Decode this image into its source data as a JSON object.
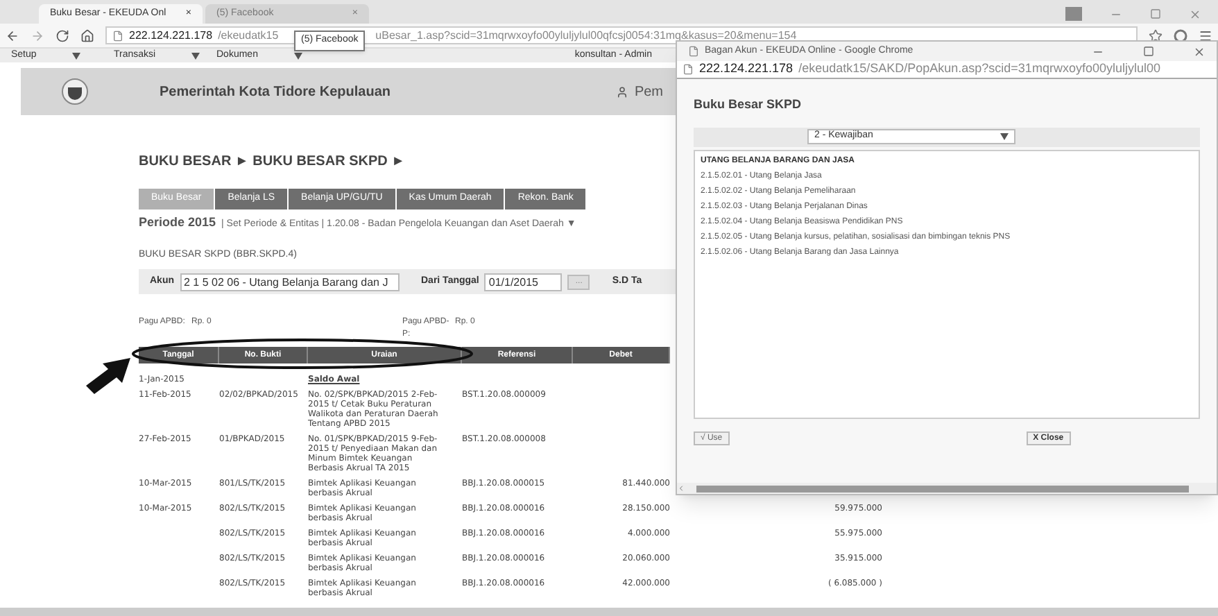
{
  "browser": {
    "tabs": [
      {
        "title": "Buku Besar - EKEUDA Onl",
        "close": "×",
        "selected": true
      },
      {
        "title": "(5) Facebook",
        "close": "×",
        "selected": false
      }
    ],
    "address": {
      "host": "222.124.221.178",
      "path_start": "/ekeudatk15",
      "path_end": "uBesar_1.asp?scid=31mqrwxoyfo00yluljylul00qfcsj0054:31mq&kasus=20&menu=154"
    },
    "tooltip": "(5) Facebook"
  },
  "menu": {
    "items": [
      "Setup",
      "Transaksi",
      "Dokumen"
    ],
    "user": "konsultan - Admin"
  },
  "header": {
    "title": "Pemerintah Kota Tidore Kepulauan",
    "user_link": "Pem"
  },
  "breadcrumb": "BUKU BESAR ► BUKU BESAR SKPD ►",
  "tabs": [
    {
      "label": "Buku Besar",
      "selected": true
    },
    {
      "label": "Belanja LS",
      "selected": false
    },
    {
      "label": "Belanja UP/GU/TU",
      "selected": false
    },
    {
      "label": "Kas Umum Daerah",
      "selected": false
    },
    {
      "label": "Rekon. Bank",
      "selected": false
    }
  ],
  "periode": {
    "label": "Periode 2015",
    "details": "| Set Periode & Entitas | 1.20.08 - Badan Pengelola Keuangan dan Aset Daerah ▼"
  },
  "section_title": "BUKU BESAR SKPD (BBR.SKPD.4)",
  "filter": {
    "akun_label": "Akun",
    "akun_value": "2 1 5 02 06 - Utang Belanja Barang dan J",
    "date_label": "Dari Tanggal",
    "date_value": "01/1/2015",
    "picker": "...",
    "to_label": "S.D Ta"
  },
  "pagu": [
    {
      "label": "Pagu APBD:",
      "value": "Rp. 0"
    },
    {
      "label": "Pagu APBD-P:",
      "value": "Rp. 0"
    }
  ],
  "table": {
    "columns": [
      "Tanggal",
      "No. Bukti",
      "Uraian",
      "Referensi",
      "Debet"
    ],
    "rows": [
      {
        "kind": "opening",
        "tanggal": "1-Jan-2015",
        "uraian": "Saldo Awal"
      },
      {
        "kind": "entry",
        "tanggal": "11-Feb-2015",
        "no_bukti": "02/02/BPKAD/2015",
        "uraian": "No. 02/SPK/BPKAD/2015 2-Feb-2015 t/ Cetak Buku Peraturan Walikota dan Peraturan Daerah Tentang APBD 2015",
        "referensi": "BST.1.20.08.000009"
      },
      {
        "kind": "entry",
        "tanggal": "27-Feb-2015",
        "no_bukti": "01/BPKAD/2015",
        "uraian": "No. 01/SPK/BPKAD/2015 9-Feb-2015 t/ Penyediaan Makan dan Minum Bimtek Keuangan Berbasis Akrual TA 2015",
        "referensi": "BST.1.20.08.000008"
      },
      {
        "kind": "entry",
        "tanggal": "10-Mar-2015",
        "no_bukti": "801/LS/TK/2015",
        "uraian": "Bimtek Aplikasi Keuangan berbasis Akrual",
        "referensi": "BBJ.1.20.08.000015",
        "debet": "81.440.000"
      },
      {
        "kind": "entry",
        "tanggal": "10-Mar-2015",
        "no_bukti": "802/LS/TK/2015",
        "uraian": "Bimtek Aplikasi Keuangan berbasis Akrual",
        "referensi": "BBJ.1.20.08.000016",
        "debet": "28.150.000",
        "saldo": "59.975.000"
      },
      {
        "kind": "entry",
        "no_bukti": "802/LS/TK/2015",
        "uraian": "Bimtek Aplikasi Keuangan berbasis Akrual",
        "referensi": "BBJ.1.20.08.000016",
        "debet": "4.000.000",
        "saldo": "55.975.000"
      },
      {
        "kind": "entry",
        "no_bukti": "802/LS/TK/2015",
        "uraian": "Bimtek Aplikasi Keuangan berbasis Akrual",
        "referensi": "BBJ.1.20.08.000016",
        "debet": "20.060.000",
        "saldo": "35.915.000"
      },
      {
        "kind": "entry",
        "no_bukti": "802/LS/TK/2015",
        "uraian": "Bimtek Aplikasi Keuangan berbasis Akrual",
        "referensi": "BBJ.1.20.08.000016",
        "debet": "42.000.000",
        "saldo": "( 6.085.000 )"
      }
    ]
  },
  "popup": {
    "window_title": "Bagan Akun - EKEUDA Online - Google Chrome",
    "url_host": "222.124.221.178",
    "url_path": "/ekeudatk15/SAKD/PopAkun.asp?scid=31mqrwxoyfo00yluljylul00",
    "heading": "Buku Besar SKPD",
    "select": "2 - Kewajiban",
    "group": "UTANG BELANJA BARANG DAN JASA",
    "items": [
      {
        "label": "2.1.5.02.01 - Utang Belanja Jasa",
        "selected": false
      },
      {
        "label": "2.1.5.02.02 - Utang Belanja Pemeliharaan",
        "selected": false
      },
      {
        "label": "2.1.5.02.03 - Utang Belanja Perjalanan Dinas",
        "selected": false
      },
      {
        "label": "2.1.5.02.04 - Utang Belanja Beasiswa Pendidikan PNS",
        "selected": false
      },
      {
        "label": "2.1.5.02.05 - Utang Belanja kursus, pelatihan, sosialisasi dan bimbingan teknis PNS",
        "selected": false
      },
      {
        "label": "2.1.5.02.06 - Utang Belanja Barang dan Jasa Lainnya",
        "selected": false
      }
    ],
    "use_button": "√ Use",
    "close_button": "X Close"
  }
}
